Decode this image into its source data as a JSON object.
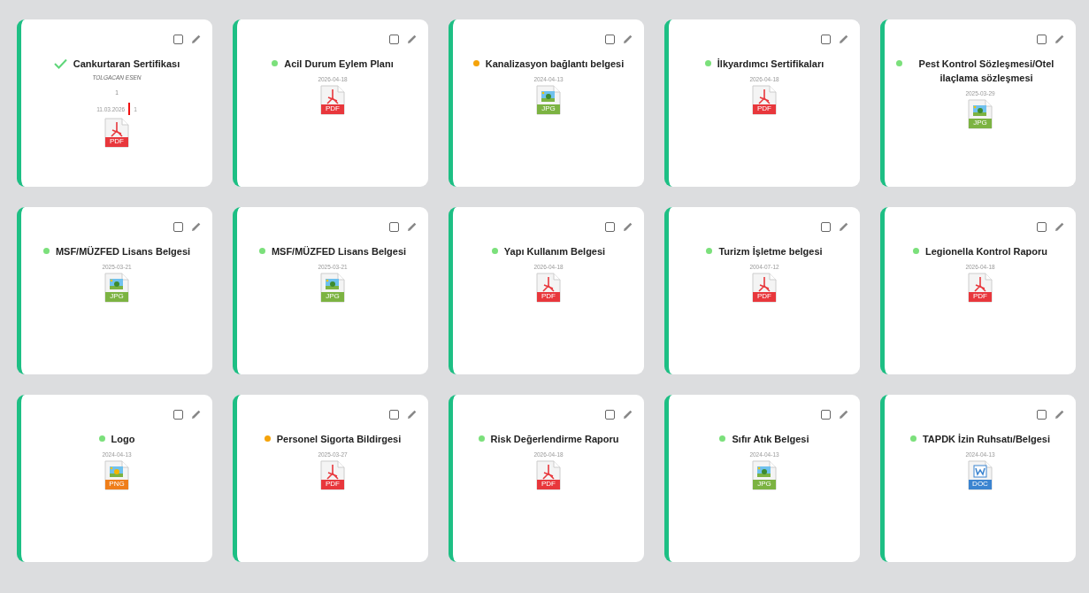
{
  "cards": [
    {
      "title": "Cankurtaran Sertifikası",
      "kind": "check",
      "checked": false,
      "owner": "TOLGACAN ESEN",
      "count": "1",
      "date": "11.03.2026",
      "date_extra": "1",
      "file_type": "PDF"
    },
    {
      "title": "Acil Durum Eylem Planı",
      "kind": "dot",
      "color": "#7be07b",
      "checked": false,
      "date": "2026-04-18",
      "file_type": "PDF"
    },
    {
      "title": "Kanalizasyon bağlantı belgesi",
      "kind": "dot",
      "color": "#f5a30a",
      "checked": false,
      "date": "2024-04-13",
      "file_type": "JPG"
    },
    {
      "title": "İlkyardımcı Sertifikaları",
      "kind": "dot",
      "color": "#7be07b",
      "checked": false,
      "date": "2026-04-18",
      "file_type": "PDF"
    },
    {
      "title": "Pest Kontrol Sözleşmesi/Otel ilaçlama sözleşmesi",
      "kind": "dot",
      "color": "#7be07b",
      "checked": false,
      "date": "2025-03-29",
      "file_type": "JPG"
    },
    {
      "title": "MSF/MÜZFED Lisans Belgesi",
      "kind": "dot",
      "color": "#7be07b",
      "checked": false,
      "date": "2025-03-21",
      "file_type": "JPG"
    },
    {
      "title": "MSF/MÜZFED Lisans Belgesi",
      "kind": "dot",
      "color": "#7be07b",
      "checked": false,
      "date": "2025-03-21",
      "file_type": "JPG"
    },
    {
      "title": "Yapı Kullanım Belgesi",
      "kind": "dot",
      "color": "#7be07b",
      "checked": false,
      "date": "2026-04-18",
      "file_type": "PDF"
    },
    {
      "title": "Turizm İşletme belgesi",
      "kind": "dot",
      "color": "#7be07b",
      "checked": false,
      "date": "2004-07-12",
      "file_type": "PDF"
    },
    {
      "title": "Legionella Kontrol Raporu",
      "kind": "dot",
      "color": "#7be07b",
      "checked": false,
      "date": "2026-04-18",
      "file_type": "PDF"
    },
    {
      "title": "Logo",
      "kind": "dot",
      "color": "#7be07b",
      "checked": false,
      "date": "2024-04-13",
      "file_type": "PNG"
    },
    {
      "title": "Personel Sigorta Bildirgesi",
      "kind": "dot",
      "color": "#f5a30a",
      "checked": false,
      "date": "2025-03-27",
      "file_type": "PDF"
    },
    {
      "title": "Risk Değerlendirme Raporu",
      "kind": "dot",
      "color": "#7be07b",
      "checked": false,
      "date": "2026-04-18",
      "file_type": "PDF"
    },
    {
      "title": "Sıfır Atık Belgesi",
      "kind": "dot",
      "color": "#7be07b",
      "checked": false,
      "date": "2024-04-13",
      "file_type": "JPG"
    },
    {
      "title": "TAPDK İzin Ruhsatı/Belgesi",
      "kind": "dot",
      "color": "#7be07b",
      "checked": false,
      "date": "2024-04-13",
      "file_type": "DOC"
    }
  ]
}
